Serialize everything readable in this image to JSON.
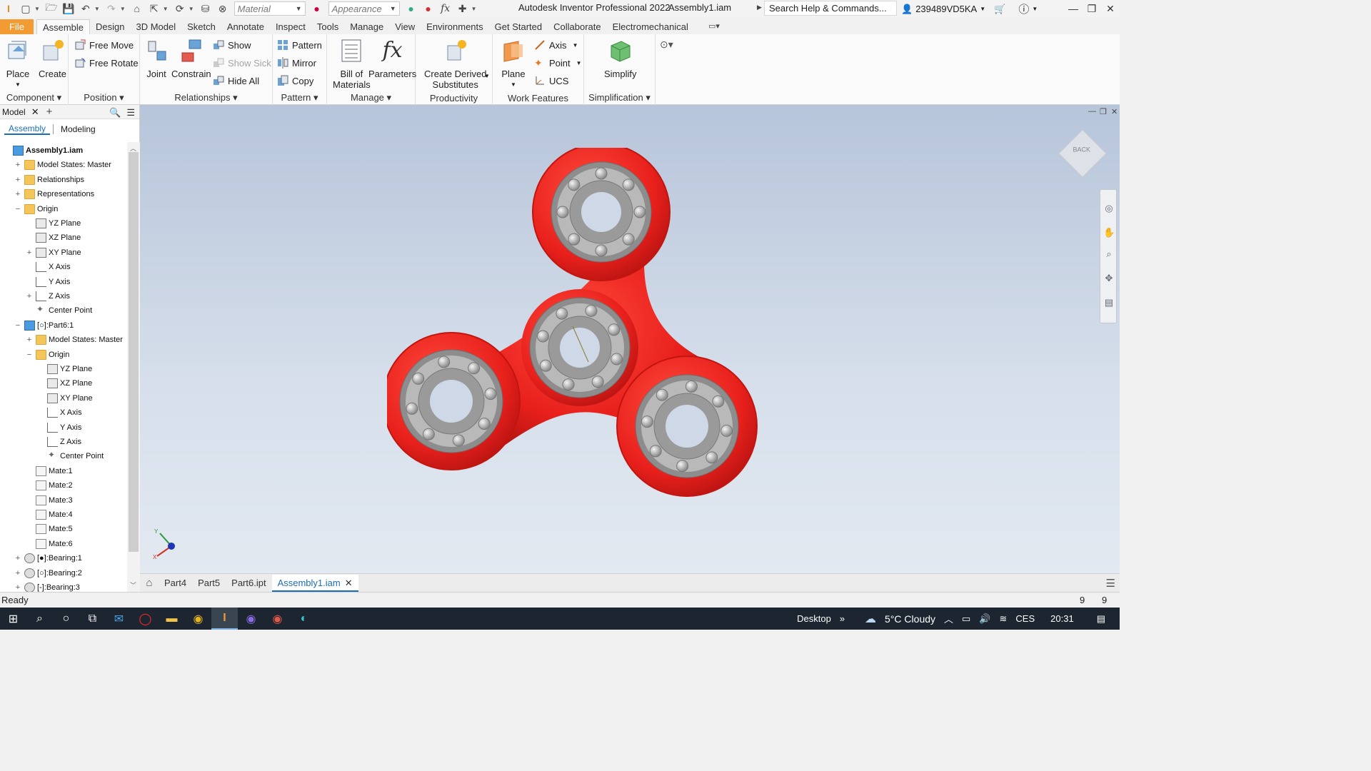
{
  "titlebar": {
    "material_placeholder": "Material",
    "appearance_placeholder": "Appearance",
    "app_title": "Autodesk Inventor Professional 2022",
    "doc_title": "Assembly1.iam",
    "search_placeholder": "Search Help & Commands...",
    "user_id": "239489VD5KA"
  },
  "ribbon_tabs": [
    "File",
    "Assemble",
    "Design",
    "3D Model",
    "Sketch",
    "Annotate",
    "Inspect",
    "Tools",
    "Manage",
    "View",
    "Environments",
    "Get Started",
    "Collaborate",
    "Electromechanical"
  ],
  "ribbon": {
    "component": {
      "label": "Component",
      "place": "Place",
      "create": "Create"
    },
    "position": {
      "label": "Position",
      "free_move": "Free Move",
      "free_rotate": "Free Rotate"
    },
    "relationships": {
      "label": "Relationships",
      "joint": "Joint",
      "constrain": "Constrain",
      "show": "Show",
      "show_sick": "Show Sick",
      "hide_all": "Hide All"
    },
    "pattern": {
      "label": "Pattern",
      "pattern": "Pattern",
      "mirror": "Mirror",
      "copy": "Copy"
    },
    "manage": {
      "label": "Manage",
      "bom_1": "Bill of",
      "bom_2": "Materials",
      "parameters": "Parameters"
    },
    "productivity": {
      "label": "Productivity",
      "cds_1": "Create Derived",
      "cds_2": "Substitutes"
    },
    "work_features": {
      "label": "Work Features",
      "plane": "Plane",
      "axis": "Axis",
      "point": "Point",
      "ucs": "UCS"
    },
    "simplification": {
      "label": "Simplification",
      "simplify": "Simplify"
    }
  },
  "browser": {
    "tab_label": "Model",
    "subtabs": [
      "Assembly",
      "Modeling"
    ],
    "tree": [
      {
        "label": "Assembly1.iam",
        "indent": 0,
        "icon": "assembly-icon",
        "toggle": ""
      },
      {
        "label": "Model States: Master",
        "indent": 1,
        "icon": "folder-icon",
        "toggle": "+"
      },
      {
        "label": "Relationships",
        "indent": 1,
        "icon": "folder-icon",
        "toggle": "+"
      },
      {
        "label": "Representations",
        "indent": 1,
        "icon": "folder-icon",
        "toggle": "+"
      },
      {
        "label": "Origin",
        "indent": 1,
        "icon": "folder-icon",
        "toggle": "−"
      },
      {
        "label": "YZ Plane",
        "indent": 2,
        "icon": "plane-icon",
        "toggle": ""
      },
      {
        "label": "XZ Plane",
        "indent": 2,
        "icon": "plane-icon",
        "toggle": ""
      },
      {
        "label": "XY Plane",
        "indent": 2,
        "icon": "plane-icon",
        "toggle": "+"
      },
      {
        "label": "X Axis",
        "indent": 2,
        "icon": "axis-icon",
        "toggle": ""
      },
      {
        "label": "Y Axis",
        "indent": 2,
        "icon": "axis-icon",
        "toggle": ""
      },
      {
        "label": "Z Axis",
        "indent": 2,
        "icon": "axis-icon",
        "toggle": "+"
      },
      {
        "label": "Center Point",
        "indent": 2,
        "icon": "point-icon",
        "toggle": ""
      },
      {
        "label": "[○]:Part6:1",
        "indent": 1,
        "icon": "part-icon",
        "toggle": "−"
      },
      {
        "label": "Model States: Master",
        "indent": 2,
        "icon": "folder-icon",
        "toggle": "+"
      },
      {
        "label": "Origin",
        "indent": 2,
        "icon": "folder-icon",
        "toggle": "−"
      },
      {
        "label": "YZ Plane",
        "indent": 3,
        "icon": "plane-icon",
        "toggle": ""
      },
      {
        "label": "XZ Plane",
        "indent": 3,
        "icon": "plane-icon",
        "toggle": ""
      },
      {
        "label": "XY Plane",
        "indent": 3,
        "icon": "plane-icon",
        "toggle": ""
      },
      {
        "label": "X Axis",
        "indent": 3,
        "icon": "axis-icon",
        "toggle": ""
      },
      {
        "label": "Y Axis",
        "indent": 3,
        "icon": "axis-icon",
        "toggle": ""
      },
      {
        "label": "Z Axis",
        "indent": 3,
        "icon": "axis-icon",
        "toggle": ""
      },
      {
        "label": "Center Point",
        "indent": 3,
        "icon": "point-icon",
        "toggle": ""
      },
      {
        "label": "Mate:1",
        "indent": 2,
        "icon": "mate-icon",
        "toggle": ""
      },
      {
        "label": "Mate:2",
        "indent": 2,
        "icon": "mate-icon",
        "toggle": ""
      },
      {
        "label": "Mate:3",
        "indent": 2,
        "icon": "mate-icon",
        "toggle": ""
      },
      {
        "label": "Mate:4",
        "indent": 2,
        "icon": "mate-icon",
        "toggle": ""
      },
      {
        "label": "Mate:5",
        "indent": 2,
        "icon": "mate-icon",
        "toggle": ""
      },
      {
        "label": "Mate:6",
        "indent": 2,
        "icon": "mate-icon",
        "toggle": ""
      },
      {
        "label": "[●]:Bearing:1",
        "indent": 1,
        "icon": "bearing-icon",
        "toggle": "+"
      },
      {
        "label": "[○]:Bearing:2",
        "indent": 1,
        "icon": "bearing-icon",
        "toggle": "+"
      },
      {
        "label": "[-]:Bearing:3",
        "indent": 1,
        "icon": "bearing-icon",
        "toggle": "+"
      }
    ]
  },
  "viewport": {
    "viewcube_face": "BACK",
    "spinner_color": "#e8201c",
    "background_color": "#c6d2e3"
  },
  "doc_tabs": [
    "Part4",
    "Part5",
    "Part6.ipt",
    "Assembly1.iam"
  ],
  "status": {
    "text": "Ready",
    "count_1": "9",
    "count_2": "9"
  },
  "taskbar": {
    "desktop_label": "Desktop",
    "weather": "5°C  Cloudy",
    "language": "CES",
    "time": "20:31"
  }
}
